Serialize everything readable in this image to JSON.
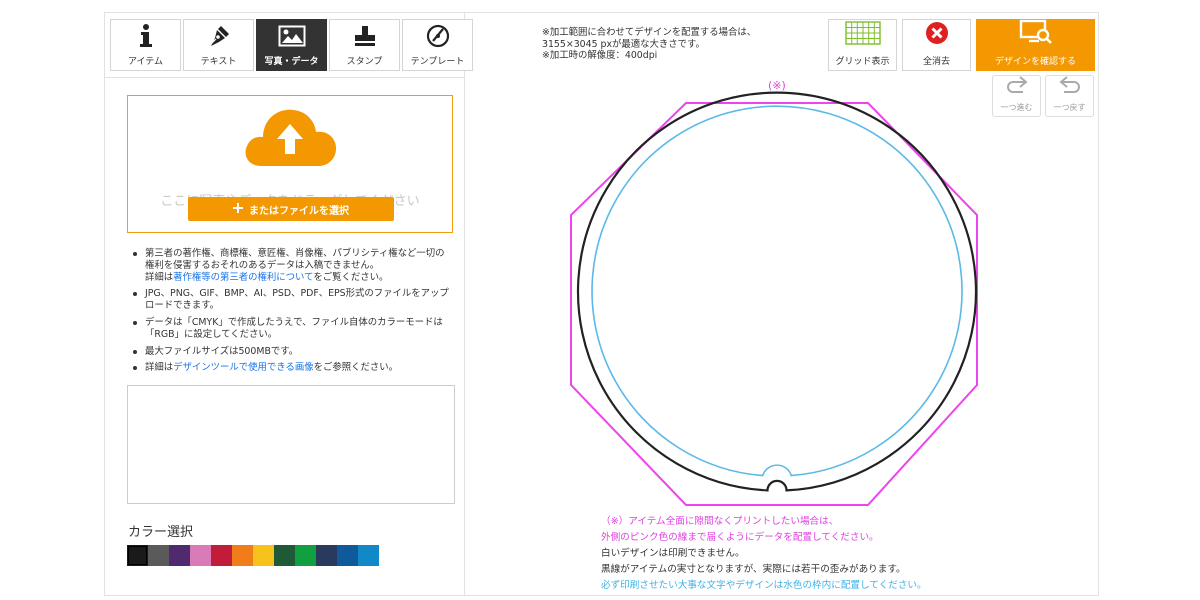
{
  "tabs": [
    {
      "label": "アイテム",
      "icon": "info-icon"
    },
    {
      "label": "テキスト",
      "icon": "pen-icon"
    },
    {
      "label": "写真・データ",
      "icon": "image-icon"
    },
    {
      "label": "スタンプ",
      "icon": "stamp-icon"
    },
    {
      "label": "テンプレート",
      "icon": "template-icon"
    }
  ],
  "active_tab": "写真・データ",
  "upload": {
    "drop_text": "ここに写真やデータをドラッグしてください",
    "select_label": "またはファイルを選択"
  },
  "notes": {
    "n1_a": "第三者の著作権、商標権、意匠権、肖像権、パブリシティ権など一切の権利を侵害するおそれのあるデータは入稿できません。",
    "n1_b": "詳細は",
    "n1_link": "著作権等の第三者の権利について",
    "n1_c": "をご覧ください。",
    "n2": "JPG、PNG、GIF、BMP、AI、PSD、PDF、EPS形式のファイルをアップロードできます。",
    "n3": "データは「CMYK」で作成したうえで、ファイル自体のカラーモードは「RGB」に設定してください。",
    "n4": "最大ファイルサイズは500MBです。",
    "n5_a": "詳細は",
    "n5_link": "デザインツールで使用できる画像",
    "n5_b": "をご参照ください。"
  },
  "color_section": {
    "title": "カラー選択",
    "swatches": [
      "#1a1a1a",
      "#5a5a5a",
      "#4f2a6e",
      "#d97bb6",
      "#c11d3a",
      "#f07d1a",
      "#f7c21a",
      "#1e5a35",
      "#10a040",
      "#2a3a5e",
      "#0e5a9a",
      "#1188c8"
    ],
    "selected_index": 0
  },
  "notice": {
    "line1": "※加工範囲に合わせてデザインを配置する場合は、",
    "line2": "3155×3045 pxが最適な大きさです。",
    "line3": "※加工時の解像度：400dpi"
  },
  "toolbar": {
    "grid_label": "グリッド表示",
    "clear_label": "全消去",
    "confirm_label": "デザインを確認する",
    "redo_label": "一つ進む",
    "undo_label": "一つ戻す"
  },
  "canvas": {
    "asterisk_label": "(※)",
    "colors": {
      "bleed": "#ee44ee",
      "item": "#222222",
      "safe": "#5ab9e8"
    }
  },
  "caption": {
    "line1": "（※）アイテム全面に隙間なくプリントしたい場合は、",
    "line2": "外側のピンク色の線まで届くようにデータを配置してください。",
    "line3": "白いデザインは印刷できません。",
    "line4": "黒線がアイテムの実寸となりますが、実際には若干の歪みがあります。",
    "line5": "必ず印刷させたい大事な文字やデザインは水色の枠内に配置してください。"
  },
  "accent_color": "#f39800"
}
